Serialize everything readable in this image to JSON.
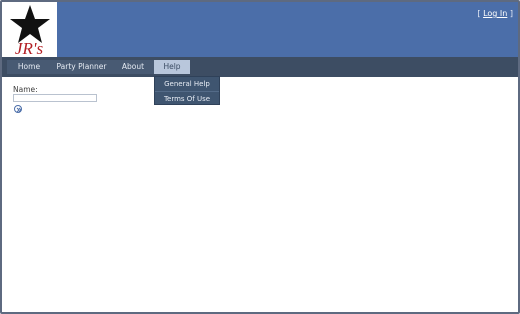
{
  "brand": {
    "logo_text": "JR's"
  },
  "header": {
    "login_open": "[",
    "login_text": "Log In",
    "login_close": "]"
  },
  "menu": {
    "items": [
      {
        "label": "Home"
      },
      {
        "label": "Party Planner"
      },
      {
        "label": "About"
      },
      {
        "label": "Help"
      }
    ],
    "dropdown": [
      {
        "label": "General Help"
      },
      {
        "label": "Terms Of Use"
      }
    ]
  },
  "form": {
    "name_label": "Name:",
    "name_value": ""
  },
  "colors": {
    "header_bg": "#4b6ea9",
    "menu_bg": "#3d4d63",
    "active_menu_bg": "#b9c7dc"
  },
  "icons": {
    "logo": "star-logo-icon",
    "submit": "go-arrow-icon"
  }
}
